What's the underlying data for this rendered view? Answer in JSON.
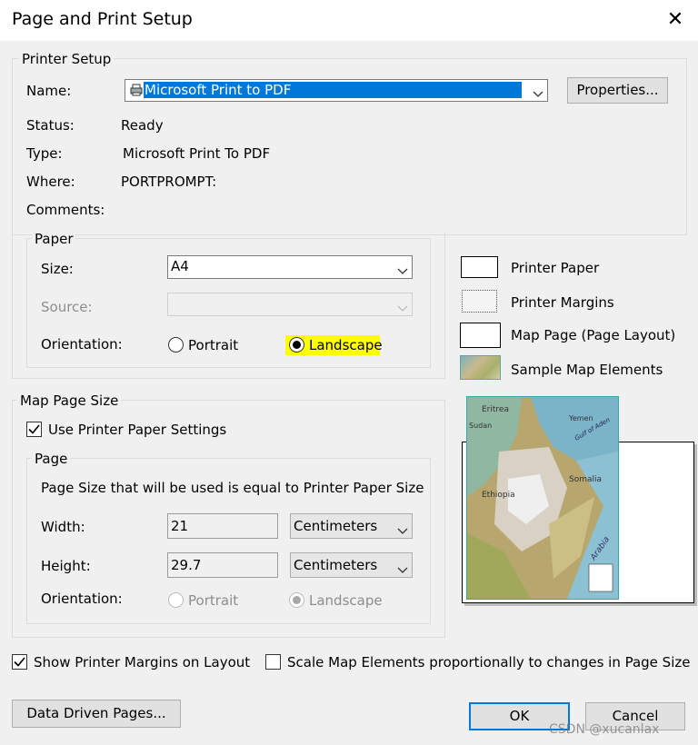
{
  "window": {
    "title": "Page and Print Setup",
    "close_glyph": "✕"
  },
  "printer_setup": {
    "group_label": "Printer Setup",
    "name_label": "Name:",
    "name_value": "Microsoft Print to PDF",
    "properties_button": "Properties...",
    "status_label": "Status:",
    "status_value": "Ready",
    "type_label": "Type:",
    "type_value": "Microsoft Print To PDF",
    "where_label": "Where:",
    "where_value": "PORTPROMPT:",
    "comments_label": "Comments:"
  },
  "paper": {
    "group_label": "Paper",
    "size_label": "Size:",
    "size_value": "A4",
    "source_label": "Source:",
    "source_value": "",
    "orientation_label": "Orientation:",
    "portrait_label": "Portrait",
    "landscape_label": "Landscape",
    "selected": "Landscape",
    "highlight_color": "#ffff00"
  },
  "legend": {
    "printer_paper": "Printer Paper",
    "printer_margins": "Printer Margins",
    "map_page": "Map Page (Page Layout)",
    "sample_map": "Sample Map Elements"
  },
  "map_page_size": {
    "group_label": "Map Page Size",
    "use_printer_paper": "Use Printer Paper Settings",
    "use_printer_paper_checked": true,
    "page_group_label": "Page",
    "info_text": "Page Size that will be used is equal to Printer Paper Size",
    "width_label": "Width:",
    "width_value": "21",
    "width_unit": "Centimeters",
    "height_label": "Height:",
    "height_value": "29.7",
    "height_unit": "Centimeters",
    "orientation_label": "Orientation:",
    "portrait_label": "Portrait",
    "landscape_label": "Landscape"
  },
  "options": {
    "show_margins": "Show Printer Margins on Layout",
    "show_margins_checked": true,
    "scale_elements": "Scale Map Elements proportionally to changes in Page Size",
    "scale_elements_checked": false
  },
  "buttons": {
    "data_driven": "Data Driven Pages...",
    "ok": "OK",
    "cancel": "Cancel"
  },
  "watermark": "CSDN @xucanlax",
  "preview_map_labels": {
    "eritrea": "Eritrea",
    "sudan": "Sudan",
    "yemen": "Yemen",
    "gulf": "Gulf of Aden",
    "ethiopia": "Ethiopia",
    "somalia": "Somalia",
    "arabia": "Arabia"
  }
}
